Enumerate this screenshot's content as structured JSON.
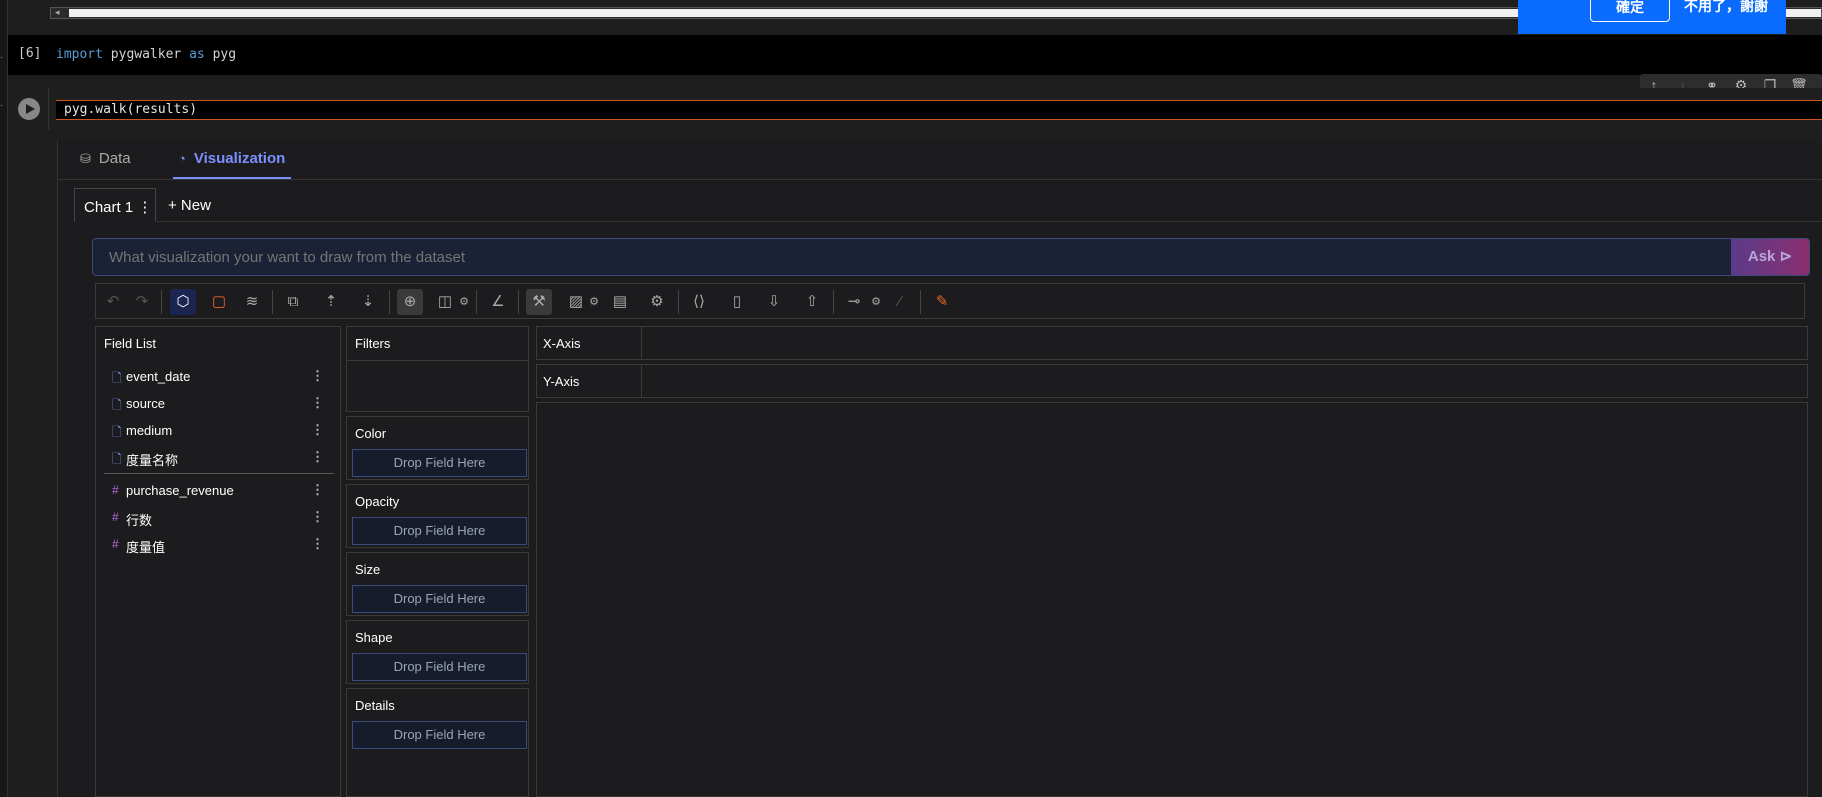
{
  "cells": {
    "cell6": {
      "prompt": "[6]",
      "kw_import": "import",
      "module": "pygwalker",
      "kw_as": "as",
      "alias": "pyg"
    },
    "cell7": {
      "code": "pyg.walk(results)"
    }
  },
  "popup": {
    "confirm": "確定",
    "decline": "不用了，謝謝",
    "color": "#0a6cff"
  },
  "cell_toolbar": {
    "icons": [
      "arrow-up-icon",
      "arrow-down-icon",
      "link-icon",
      "gear-icon",
      "copy-icon",
      "trash-icon"
    ]
  },
  "tabs": {
    "data": "Data",
    "visualization": "Visualization",
    "accent": "#7b8fff"
  },
  "chart_tabs": {
    "chart1": "Chart 1",
    "menu": "⋮",
    "new": "+ New"
  },
  "ask": {
    "placeholder": "What visualization your want to draw from the dataset",
    "button": "Ask"
  },
  "toolbar_icons": [
    "undo-icon",
    "redo-icon",
    "cube-icon",
    "mark-type-icon",
    "layers-icon",
    "transpose-icon",
    "sort-ascending-icon",
    "sort-descending-icon",
    "zoom-icon",
    "resize-icon",
    "axis-scale-icon",
    "brush-icon",
    "image-export-icon",
    "table-icon",
    "settings-icon",
    "code-icon",
    "document-icon",
    "download-icon",
    "upload-icon",
    "timeline-icon",
    "paintbrush-icon",
    "kanaries-logo-icon"
  ],
  "field_list": {
    "header": "Field List",
    "dimensions": [
      "event_date",
      "source",
      "medium",
      "度量名称"
    ],
    "measures": [
      "purchase_revenue",
      "行数",
      "度量值"
    ]
  },
  "encodings": {
    "filters": "Filters",
    "color": "Color",
    "opacity": "Opacity",
    "size": "Size",
    "shape": "Shape",
    "details": "Details",
    "drop_text": "Drop Field Here"
  },
  "axes": {
    "x": "X-Axis",
    "y": "Y-Axis"
  }
}
